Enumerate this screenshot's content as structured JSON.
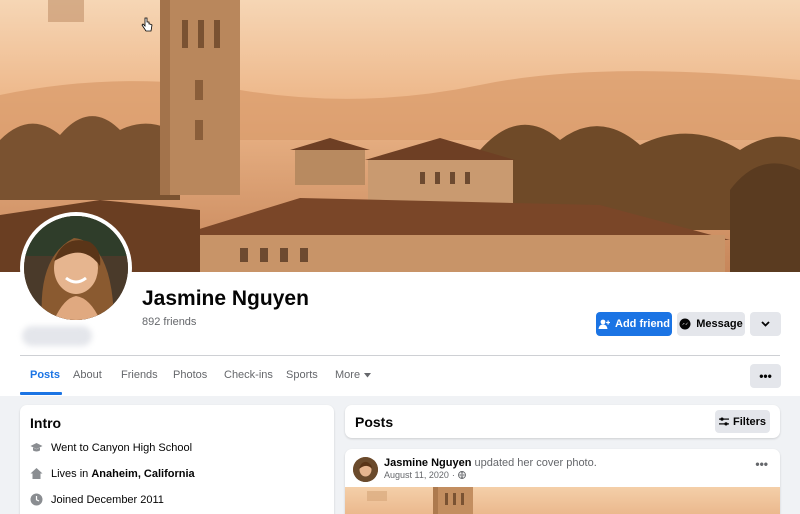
{
  "profile": {
    "name": "Jasmine Nguyen",
    "friends_count": "892 friends"
  },
  "actions": {
    "add_friend": "Add friend",
    "message": "Message",
    "dropdown_icon": "chevron-down-icon"
  },
  "tabs": [
    {
      "label": "Posts",
      "active": true
    },
    {
      "label": "About",
      "active": false
    },
    {
      "label": "Friends",
      "active": false
    },
    {
      "label": "Photos",
      "active": false
    },
    {
      "label": "Check-ins",
      "active": false
    },
    {
      "label": "Sports",
      "active": false
    },
    {
      "label": "More",
      "active": false
    }
  ],
  "tab_more_button": "•••",
  "intro": {
    "title": "Intro",
    "items": [
      {
        "icon": "graduation-cap-icon",
        "text": "Went to Canyon High School",
        "bold": ""
      },
      {
        "icon": "home-icon",
        "text": "Lives in ",
        "bold": "Anaheim, California"
      },
      {
        "icon": "clock-icon",
        "text": "Joined December 2011",
        "bold": ""
      }
    ]
  },
  "posts": {
    "title": "Posts",
    "filters_label": "Filters"
  },
  "post": {
    "author": "Jasmine Nguyen",
    "action": " updated her cover photo.",
    "date": "August 11, 2020",
    "separator": "·",
    "menu": "•••"
  },
  "colors": {
    "accent": "#1b74e4",
    "button_gray": "#e4e6eb",
    "page_bg": "#f0f2f5",
    "secondary_text": "#65676b"
  }
}
